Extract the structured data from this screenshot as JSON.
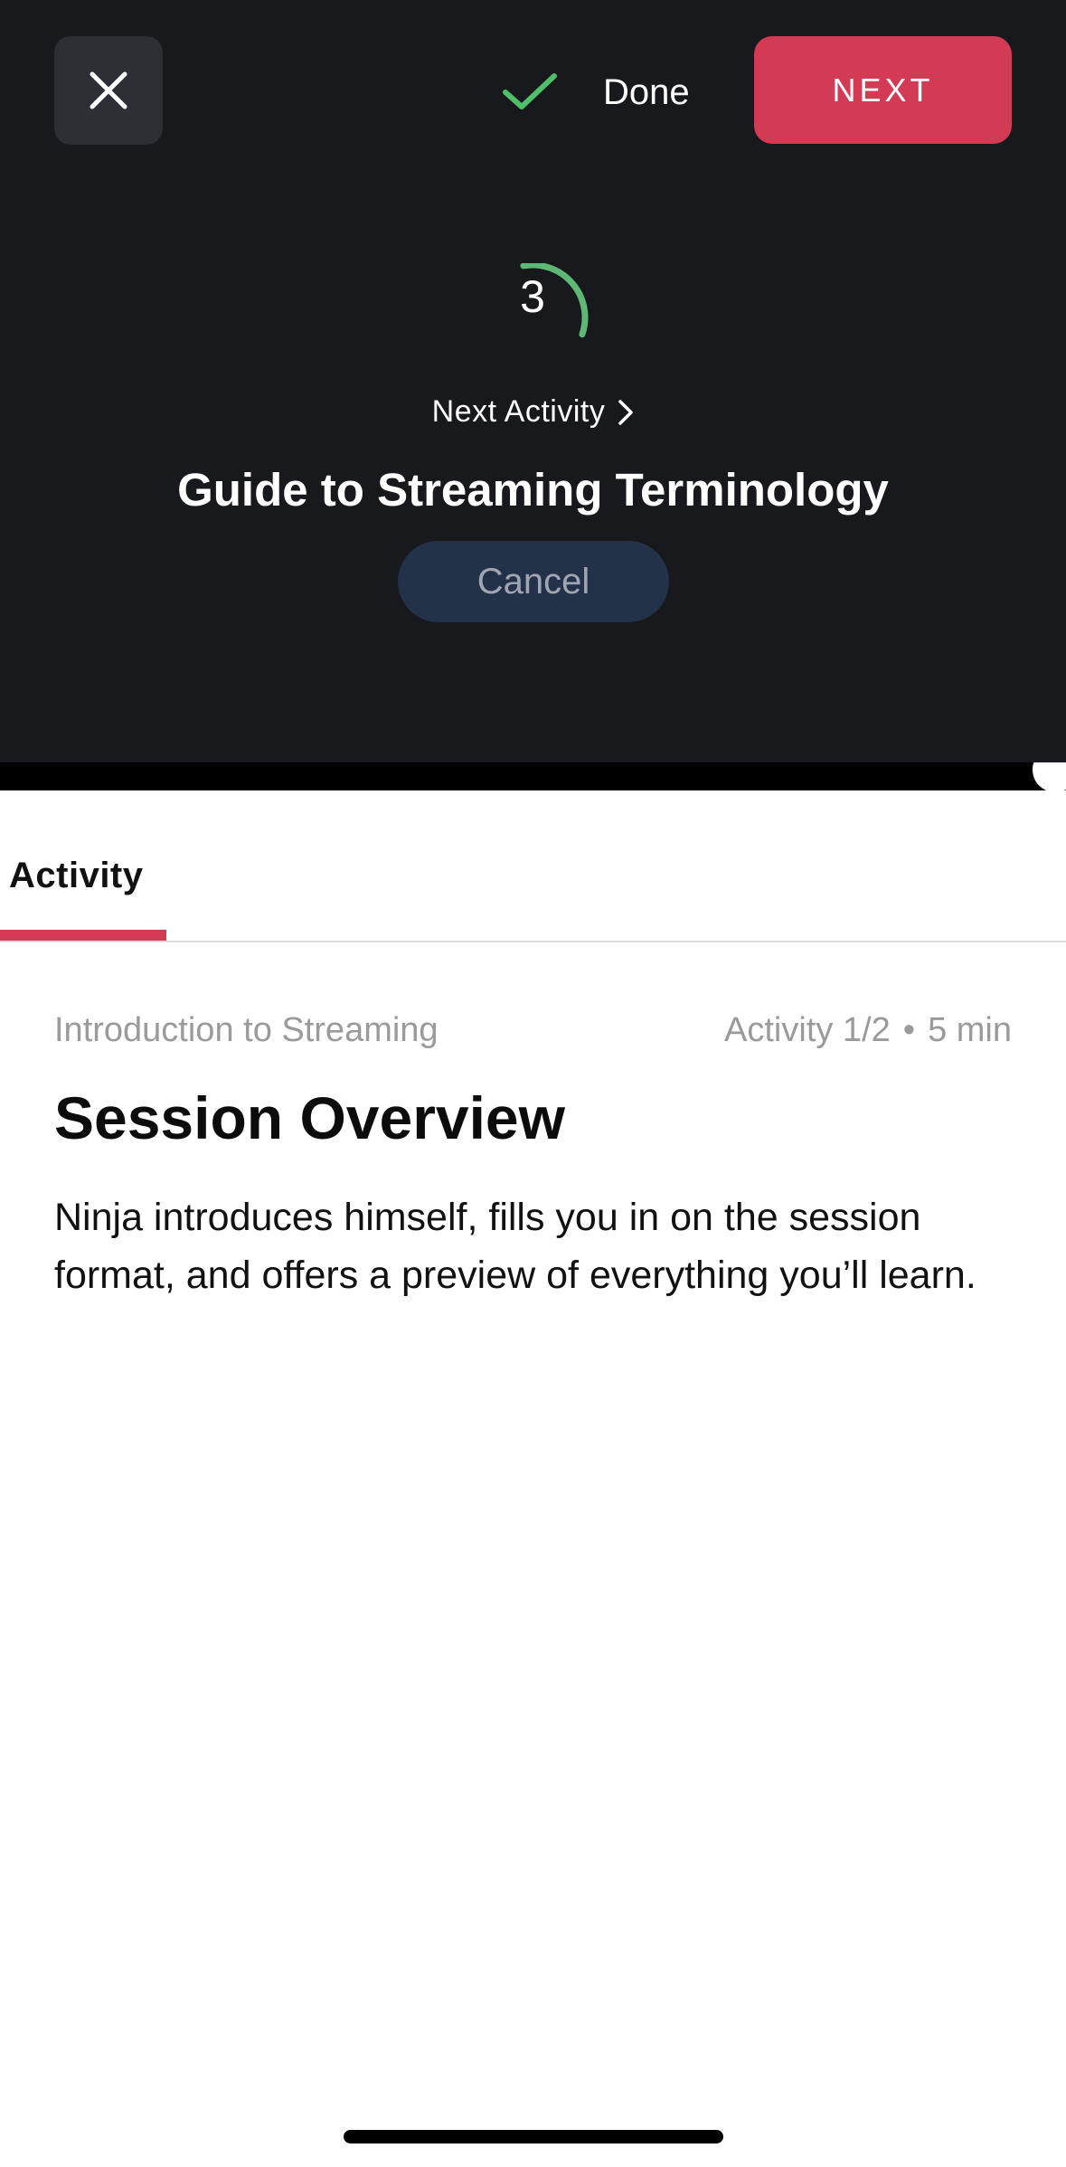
{
  "header": {
    "done_label": "Done",
    "next_label": "NEXT"
  },
  "countdown": {
    "number": "3",
    "progress": 0.33,
    "ring_color": "#5cb874"
  },
  "up_next": {
    "label": "Next Activity",
    "title": "Guide to Streaming Terminology",
    "cancel_label": "Cancel"
  },
  "tabs": [
    {
      "label": "Activity",
      "active": true
    }
  ],
  "activity": {
    "course": "Introduction to Streaming",
    "position": "Activity 1/2",
    "separator": "•",
    "duration": "5 min",
    "title": "Session Overview",
    "description": "Ninja introduces himself, fills you in on the session format, and offers a preview of everything you’ll learn."
  },
  "colors": {
    "accent": "#d33b55",
    "check": "#4fbf6a",
    "overlay": "#18191d"
  },
  "icons": {
    "close": "close-icon",
    "check": "check-icon",
    "chevron": "chevron-right-icon"
  }
}
